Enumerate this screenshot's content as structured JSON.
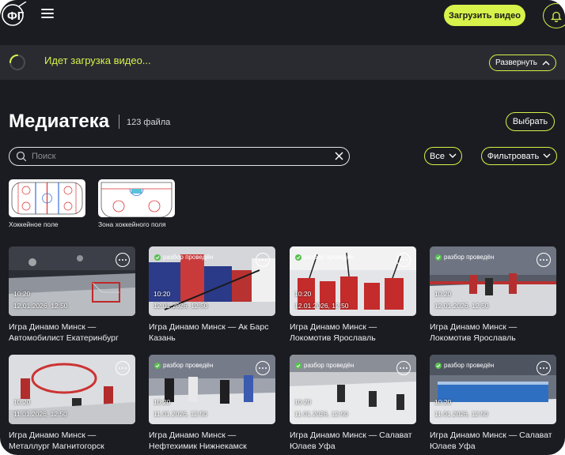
{
  "header": {
    "upload_button": "Загрузить видео"
  },
  "upload_status": {
    "text": "Идет загрузка видео...",
    "expand_button": "Развернуть"
  },
  "library": {
    "title": "Медиатека",
    "count": "123 файла",
    "select_button": "Выбрать"
  },
  "search": {
    "placeholder": "Поиск",
    "value": ""
  },
  "filters": {
    "all_label": "Все",
    "filter_label": "Фильтровать"
  },
  "templates": [
    {
      "label": "Хоккейное поле"
    },
    {
      "label": "Зона хоккейного поля"
    }
  ],
  "videos": [
    {
      "status": "",
      "duration": "10:20",
      "date": "12.01.2026, 12:50",
      "title_line1": "Игра Динамо Минск —",
      "title_line2": "Автомобилист Екатеринбург"
    },
    {
      "status": "разбор проведён",
      "duration": "10:20",
      "date": "12.01.2026, 12:50",
      "title_line1": "Игра Динамо Минск — Ак Барс",
      "title_line2": "Казань"
    },
    {
      "status": "разбор проведён",
      "duration": "10:20",
      "date": "12.01.2026, 12:50",
      "title_line1": "Игра Динамо Минск —",
      "title_line2": "Локомотив Ярославль"
    },
    {
      "status": "разбор проведён",
      "duration": "10:20",
      "date": "12.01.2026, 12:50",
      "title_line1": "Игра Динамо Минск —",
      "title_line2": "Локомотив Ярославль"
    },
    {
      "status": "",
      "duration": "10:20",
      "date": "11.01.2026, 12:50",
      "title_line1": "Игра Динамо Минск —",
      "title_line2": "Металлург Магнитогорск"
    },
    {
      "status": "разбор проведён",
      "duration": "10:20",
      "date": "11.01.2026, 12:50",
      "title_line1": "Игра Динамо Минск —",
      "title_line2": "Нефтехимик Нижнекамск"
    },
    {
      "status": "разбор проведён",
      "duration": "10:20",
      "date": "11.01.2026, 12:50",
      "title_line1": "Игра Динамо Минск — Салават",
      "title_line2": "Юлаев Уфа"
    },
    {
      "status": "разбор проведён",
      "duration": "10:20",
      "date": "11.01.2026, 12:50",
      "title_line1": "Игра Динамо Минск — Салават",
      "title_line2": "Юлаев Уфа"
    }
  ],
  "colors": {
    "accent": "#d7f24a",
    "background": "#1b1c21",
    "panel": "#2a2b31",
    "status_ok": "#58c04f"
  },
  "icons": [
    "logo-icon",
    "menu-icon",
    "bell-icon",
    "spinner-icon",
    "chevron-up-icon",
    "search-icon",
    "close-icon",
    "chevron-down-icon",
    "check-icon",
    "more-icon"
  ]
}
